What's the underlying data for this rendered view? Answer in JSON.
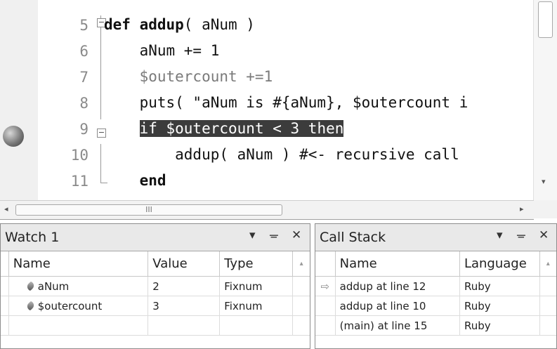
{
  "editor": {
    "lines": [
      {
        "num": "5",
        "segments": [
          {
            "t": "def ",
            "c": "kw"
          },
          {
            "t": "addup",
            "c": "kw"
          },
          {
            "t": "( aNum )",
            "c": ""
          }
        ]
      },
      {
        "num": "6",
        "segments": [
          {
            "t": "    aNum += 1",
            "c": ""
          }
        ]
      },
      {
        "num": "7",
        "segments": [
          {
            "t": "    $outercount +=1",
            "c": "gray"
          }
        ]
      },
      {
        "num": "8",
        "segments": [
          {
            "t": "    puts( \"aNum is #{aNum}, $outercount i",
            "c": ""
          }
        ]
      },
      {
        "num": "9",
        "segments": [
          {
            "t": "    ",
            "c": ""
          },
          {
            "t": "if $outercount < 3 then",
            "c": "hl"
          }
        ]
      },
      {
        "num": "10",
        "segments": [
          {
            "t": "        addup( aNum ) #<- recursive call",
            "c": ""
          }
        ]
      },
      {
        "num": "11",
        "segments": [
          {
            "t": "    end",
            "c": "kw"
          }
        ]
      }
    ],
    "hscroll_grip": "III"
  },
  "watch": {
    "title": "Watch 1",
    "buttons": {
      "dropdown": "▾",
      "pin": "ᚚ",
      "close": "✕"
    },
    "columns": [
      "Name",
      "Value",
      "Type"
    ],
    "rows": [
      {
        "name": "aNum",
        "value": "2",
        "type": "Fixnum"
      },
      {
        "name": "$outercount",
        "value": "3",
        "type": "Fixnum"
      }
    ]
  },
  "callstack": {
    "title": "Call Stack",
    "buttons": {
      "dropdown": "▾",
      "pin": "ᚚ",
      "close": "✕"
    },
    "columns": [
      "Name",
      "Language"
    ],
    "rows": [
      {
        "name": "addup at line 12",
        "language": "Ruby"
      },
      {
        "name": "addup at line 10",
        "language": "Ruby"
      },
      {
        "name": "(main) at line 15",
        "language": "Ruby"
      }
    ],
    "current_arrow": "⇨"
  }
}
